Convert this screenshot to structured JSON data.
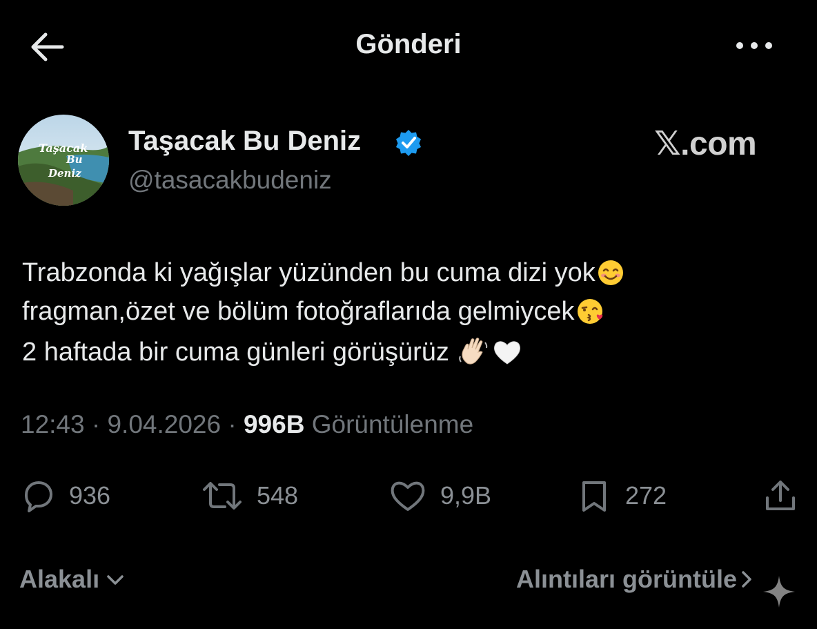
{
  "header": {
    "title": "Gönderi",
    "back_icon": "arrow-left-icon",
    "more_icon": "more-horizontal-icon"
  },
  "author": {
    "name": "Taşacak Bu Deniz",
    "handle": "@tasacakbudeniz",
    "verified": true,
    "avatar_text": [
      "Taşacak",
      "Bu",
      "Deniz"
    ]
  },
  "watermark": "𝕏.com",
  "tweet": {
    "lines": [
      "Trabzonda ki yağışlar yüzünden bu cuma dizi yok",
      "fragman,özet ve bölüm fotoğraflarıda gelmiycek",
      "2 haftada bir cuma günleri görüşürüz "
    ],
    "emojis": [
      "smiling-face-icon",
      "kissing-face-icon",
      "waving-hand-icon",
      "white-heart-icon"
    ]
  },
  "meta": {
    "time": "12:43",
    "date": "9.04.2026",
    "views_count": "996B",
    "views_label": "Görüntülenme",
    "separator": "·"
  },
  "actions": {
    "replies": "936",
    "reposts": "548",
    "likes": "9,9B",
    "bookmarks": "272"
  },
  "footer": {
    "sort_label": "Alakalı",
    "quotes_label": "Alıntıları görüntüle"
  },
  "colors": {
    "background": "#000000",
    "text": "#e7e9ea",
    "muted": "#71767b",
    "verified": "#1d9bf0"
  }
}
